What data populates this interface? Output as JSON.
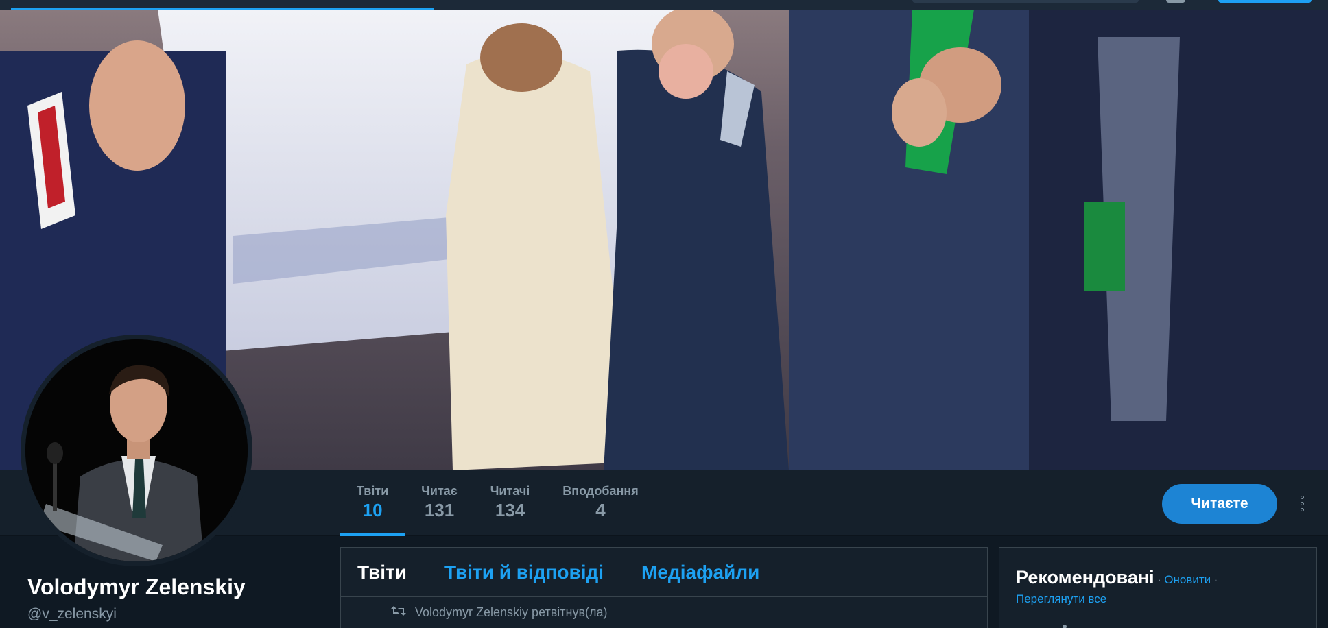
{
  "profile": {
    "name": "Volodymyr Zelenskiy",
    "handle": "@v_zelenskyi"
  },
  "stats": [
    {
      "label": "Твіти",
      "value": "10",
      "active": true
    },
    {
      "label": "Читає",
      "value": "131",
      "active": false
    },
    {
      "label": "Читачі",
      "value": "134",
      "active": false
    },
    {
      "label": "Вподобання",
      "value": "4",
      "active": false
    }
  ],
  "actions": {
    "follow_label": "Читаєте",
    "more_icon": "more-vertical-icon"
  },
  "timeline": {
    "tabs": [
      "Твіти",
      "Твіти й відповіді",
      "Медіафайли"
    ],
    "active_tab": 0,
    "retweet_text": "Volodymyr Zelenskiy ретвітнув(ла)",
    "retweet_icon": "retweet-icon"
  },
  "sidebar": {
    "title": "Рекомендовані",
    "separator": "·",
    "refresh_label": "Оновити",
    "view_all_label": "Переглянути все"
  },
  "colors": {
    "accent": "#1da1f2",
    "button": "#1d84d4",
    "background": "#0f1923",
    "panel": "#15202b",
    "muted": "#8899a6"
  }
}
